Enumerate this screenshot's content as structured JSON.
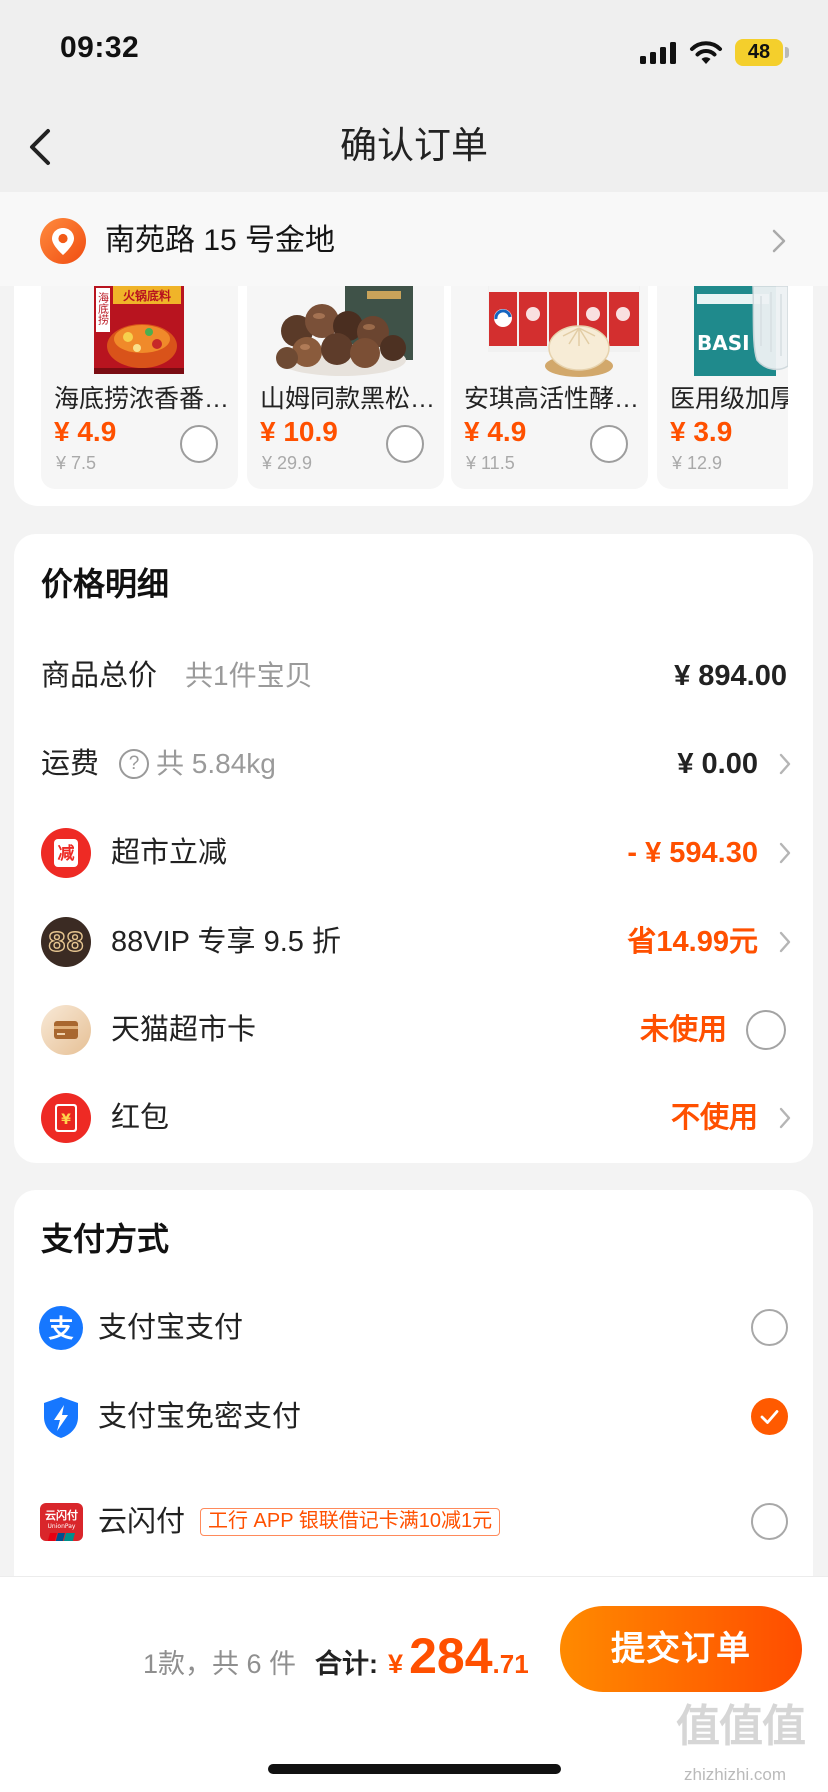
{
  "status_bar": {
    "time": "09:32",
    "battery": "48",
    "signal_icon": "cellular-signal-icon",
    "wifi_icon": "wifi-icon"
  },
  "nav": {
    "title": "确认订单",
    "back_icon": "chevron-left-icon"
  },
  "address": {
    "text": "南苑路 15 号金地",
    "icon": "location-pin-icon"
  },
  "products": [
    {
      "name": "海底捞浓香番…",
      "price": "¥ 4.9",
      "original_price": "¥ 7.5",
      "image_text": [
        "火锅底料",
        "海底捞"
      ]
    },
    {
      "name": "山姆同款黑松…",
      "price": "¥ 10.9",
      "original_price": "¥ 29.9"
    },
    {
      "name": "安琪高活性酵…",
      "price": "¥ 4.9",
      "original_price": "¥ 11.5"
    },
    {
      "name": "医用级加厚",
      "price": "¥ 3.9",
      "original_price": "¥ 12.9",
      "image_text": [
        "BASI"
      ]
    }
  ],
  "price_detail": {
    "title": "价格明细",
    "goods_total": {
      "label": "商品总价",
      "sub": "共1件宝贝",
      "value": "¥ 894.00"
    },
    "shipping": {
      "label": "运费",
      "help": "?",
      "sub": "共 5.84kg",
      "value": "¥ 0.00"
    },
    "market_discount": {
      "icon_text": "减",
      "label": "超市立减",
      "value": "- ¥ 594.30"
    },
    "vip": {
      "icon_text": "88",
      "label": "88VIP 专享 9.5 折",
      "value": "省14.99元"
    },
    "market_card": {
      "label": "天猫超市卡",
      "value": "未使用",
      "selected": false
    },
    "red_packet": {
      "icon_text": "¥",
      "label": "红包",
      "value": "不使用"
    }
  },
  "payment": {
    "title": "支付方式",
    "methods": [
      {
        "label": "支付宝支付",
        "icon_text": "支",
        "selected": false
      },
      {
        "label": "支付宝免密支付",
        "icon": "shield-lightning-icon",
        "selected": true
      },
      {
        "label": "云闪付",
        "icon_text": "云闪付",
        "icon_subtext": "UnionPay",
        "promo": "工行 APP 银联借记卡满10减1元",
        "selected": false
      }
    ]
  },
  "footer": {
    "count": "1款，共 6 件",
    "total_label": "合计:",
    "currency": "¥",
    "total_integer": "284",
    "total_decimal": ".71",
    "submit": "提交订单"
  },
  "watermark": {
    "glyphs": "值值值",
    "site": "zhizhizhi.com"
  },
  "colors": {
    "accent": "#ff5000",
    "button_start": "#ff8a00",
    "button_end": "#ff4d00",
    "alipay_blue": "#1677ff",
    "discount_red": "#ee2a24",
    "checked": "#ff5a00"
  }
}
